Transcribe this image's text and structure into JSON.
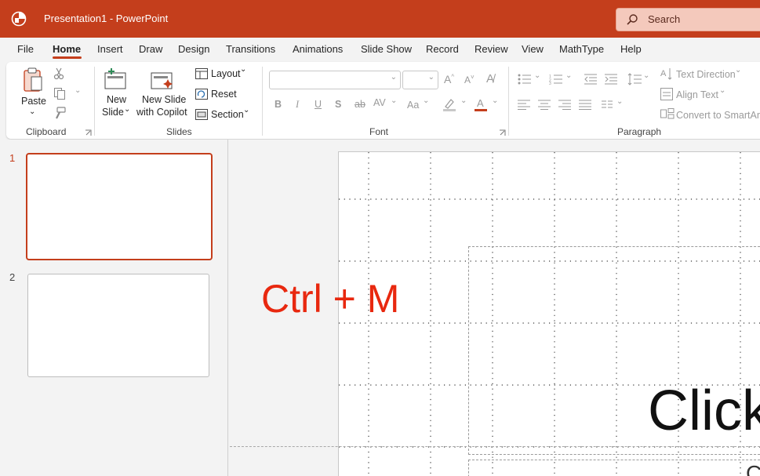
{
  "titlebar": {
    "doc_title": "Presentation1  -  PowerPoint",
    "search_placeholder": "Search",
    "bg_color": "#c43e1c"
  },
  "menu": {
    "tabs": [
      "File",
      "Home",
      "Insert",
      "Draw",
      "Design",
      "Transitions",
      "Animations",
      "Slide Show",
      "Record",
      "Review",
      "View",
      "MathType",
      "Help"
    ],
    "active": "Home"
  },
  "ribbon": {
    "clipboard": {
      "paste": "Paste",
      "label": "Clipboard"
    },
    "slides": {
      "new_slide_1": "New",
      "new_slide_2": "Slide",
      "copilot_1": "New Slide",
      "copilot_2": "with Copilot",
      "layout": "Layout",
      "reset": "Reset",
      "section": "Section",
      "label": "Slides"
    },
    "font": {
      "label": "Font",
      "change_case": "Aa"
    },
    "paragraph": {
      "text_direction": "Text Direction",
      "align_text": "Align Text",
      "convert_smartart": "Convert to SmartArt",
      "label": "Paragraph"
    }
  },
  "thumbnails": [
    {
      "number": "1",
      "selected": true
    },
    {
      "number": "2",
      "selected": false
    }
  ],
  "slide": {
    "shortcut_text": "Ctrl + M",
    "title_placeholder": "Click",
    "subtitle_placeholder": "C"
  }
}
